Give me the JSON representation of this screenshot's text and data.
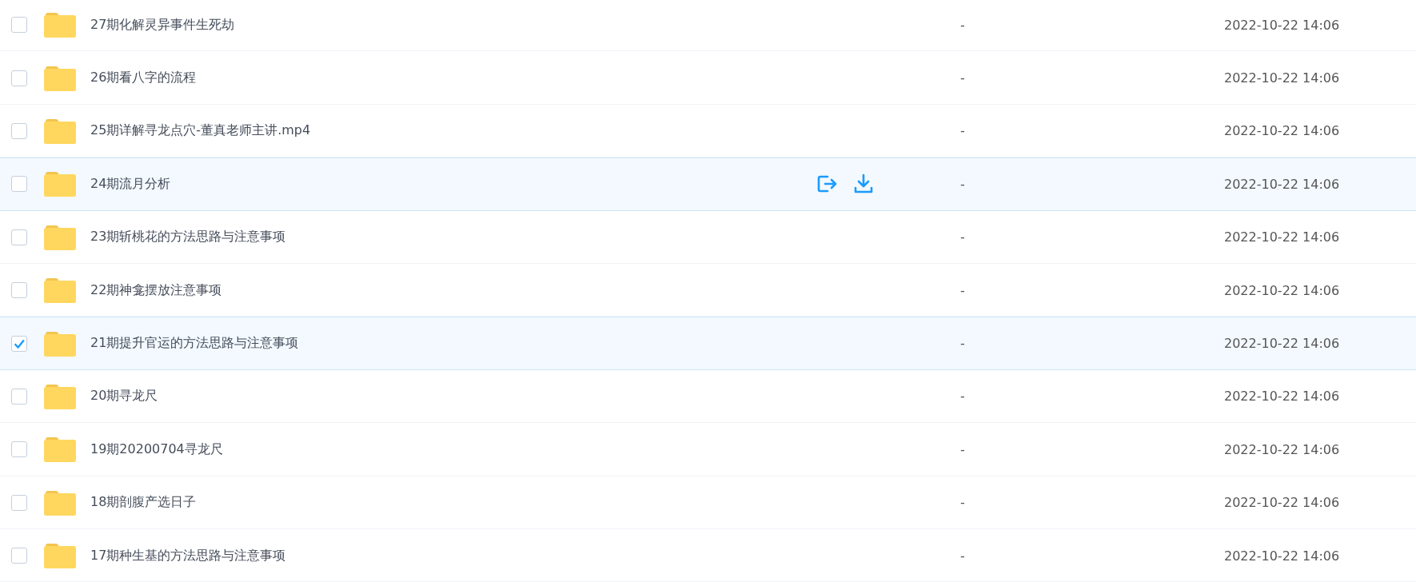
{
  "rows": [
    {
      "name": "27期化解灵异事件生死劫",
      "size": "-",
      "modified": "2022-10-22 14:06",
      "checked": false,
      "hovered": false
    },
    {
      "name": "26期看八字的流程",
      "size": "-",
      "modified": "2022-10-22 14:06",
      "checked": false,
      "hovered": false
    },
    {
      "name": "25期详解寻龙点穴-董真老师主讲.mp4",
      "size": "-",
      "modified": "2022-10-22 14:06",
      "checked": false,
      "hovered": false
    },
    {
      "name": "24期流月分析",
      "size": "-",
      "modified": "2022-10-22 14:06",
      "checked": false,
      "hovered": true
    },
    {
      "name": "23期斩桃花的方法思路与注意事项",
      "size": "-",
      "modified": "2022-10-22 14:06",
      "checked": false,
      "hovered": false
    },
    {
      "name": "22期神龛摆放注意事项",
      "size": "-",
      "modified": "2022-10-22 14:06",
      "checked": false,
      "hovered": false
    },
    {
      "name": "21期提升官运的方法思路与注意事项",
      "size": "-",
      "modified": "2022-10-22 14:06",
      "checked": true,
      "hovered": false
    },
    {
      "name": "20期寻龙尺",
      "size": "-",
      "modified": "2022-10-22 14:06",
      "checked": false,
      "hovered": false
    },
    {
      "name": "19期20200704寻龙尺",
      "size": "-",
      "modified": "2022-10-22 14:06",
      "checked": false,
      "hovered": false
    },
    {
      "name": "18期剖腹产选日子",
      "size": "-",
      "modified": "2022-10-22 14:06",
      "checked": false,
      "hovered": false
    },
    {
      "name": "17期种生基的方法思路与注意事项",
      "size": "-",
      "modified": "2022-10-22 14:06",
      "checked": false,
      "hovered": false
    }
  ]
}
